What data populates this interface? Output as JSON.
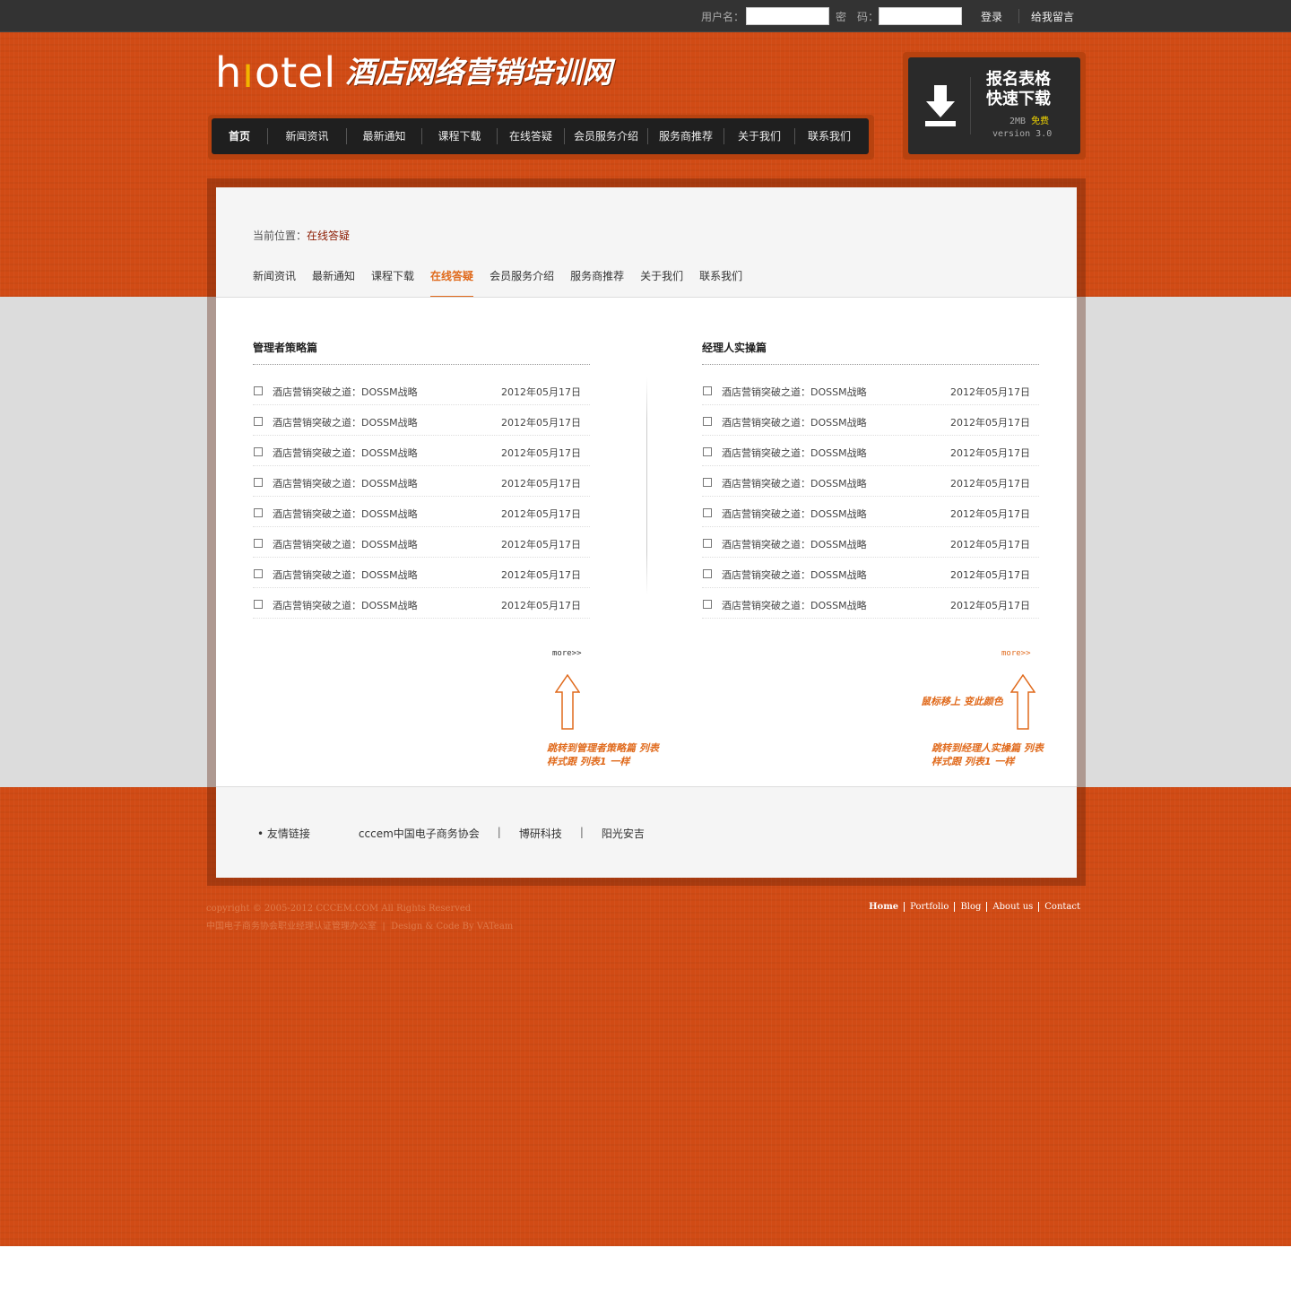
{
  "topbar": {
    "username_label": "用户名：",
    "password_label": "密　码：",
    "login": "登录",
    "message": "给我留言"
  },
  "logo": {
    "hotel_h": "h",
    "hotel_i": "ı",
    "hotel_rest": "otel",
    "name": "酒店网络营销培训网"
  },
  "nav": [
    "首页",
    "新闻资讯",
    "最新通知",
    "课程下载",
    "在线答疑",
    "会员服务介绍",
    "服务商推荐",
    "关于我们",
    "联系我们"
  ],
  "download": {
    "line1": "报名表格",
    "line2": "快速下载",
    "size": "2MB",
    "free": "免费",
    "version": "version 3.0",
    "icon": "download-arrow-icon"
  },
  "breadcrumb": {
    "label": "当前位置：",
    "current": "在线答疑"
  },
  "subnav": [
    "新闻资讯",
    "最新通知",
    "课程下载",
    "在线答疑",
    "会员服务介绍",
    "服务商推荐",
    "关于我们",
    "联系我们"
  ],
  "left": {
    "heading": "管理者策略篇",
    "items": [
      {
        "title": "酒店营销突破之道：DOSSM战略",
        "date": "2012年05月17日"
      },
      {
        "title": "酒店营销突破之道：DOSSM战略",
        "date": "2012年05月17日"
      },
      {
        "title": "酒店营销突破之道：DOSSM战略",
        "date": "2012年05月17日"
      },
      {
        "title": "酒店营销突破之道：DOSSM战略",
        "date": "2012年05月17日"
      },
      {
        "title": "酒店营销突破之道：DOSSM战略",
        "date": "2012年05月17日"
      },
      {
        "title": "酒店营销突破之道：DOSSM战略",
        "date": "2012年05月17日"
      },
      {
        "title": "酒店营销突破之道：DOSSM战略",
        "date": "2012年05月17日"
      },
      {
        "title": "酒店营销突破之道：DOSSM战略",
        "date": "2012年05月17日"
      }
    ],
    "more": "more>>",
    "note1": "跳转到管理者策略篇 列表",
    "note2": "样式跟 列表1 一样"
  },
  "right": {
    "heading": "经理人实操篇",
    "items": [
      {
        "title": "酒店营销突破之道：DOSSM战略",
        "date": "2012年05月17日"
      },
      {
        "title": "酒店营销突破之道：DOSSM战略",
        "date": "2012年05月17日"
      },
      {
        "title": "酒店营销突破之道：DOSSM战略",
        "date": "2012年05月17日"
      },
      {
        "title": "酒店营销突破之道：DOSSM战略",
        "date": "2012年05月17日"
      },
      {
        "title": "酒店营销突破之道：DOSSM战略",
        "date": "2012年05月17日"
      },
      {
        "title": "酒店营销突破之道：DOSSM战略",
        "date": "2012年05月17日"
      },
      {
        "title": "酒店营销突破之道：DOSSM战略",
        "date": "2012年05月17日"
      },
      {
        "title": "酒店营销突破之道：DOSSM战略",
        "date": "2012年05月17日"
      }
    ],
    "more": "more>>",
    "hover_note": "鼠标移上 变此颜色",
    "note1": "跳转到经理人实操篇 列表",
    "note2": "样式跟 列表1 一样"
  },
  "friends": {
    "label": "• 友情链接",
    "links": [
      "cccem中国电子商务协会",
      "博研科技",
      "阳光安吉"
    ],
    "separator": "|"
  },
  "footer": {
    "copyright": "copyright © 2005-2012 CCCEM.COM All Rights Reserved",
    "office": "中国电子商务协会职业经理认证管理办公室",
    "design": "Design & Code By VATeam",
    "separator": "|",
    "links": [
      "Home",
      "Portfolio",
      "Blog",
      "About us",
      "Contact"
    ]
  },
  "colors": {
    "accent": "#d14b15",
    "highlight": "#e06a1c",
    "dark": "#1f1f1f"
  }
}
